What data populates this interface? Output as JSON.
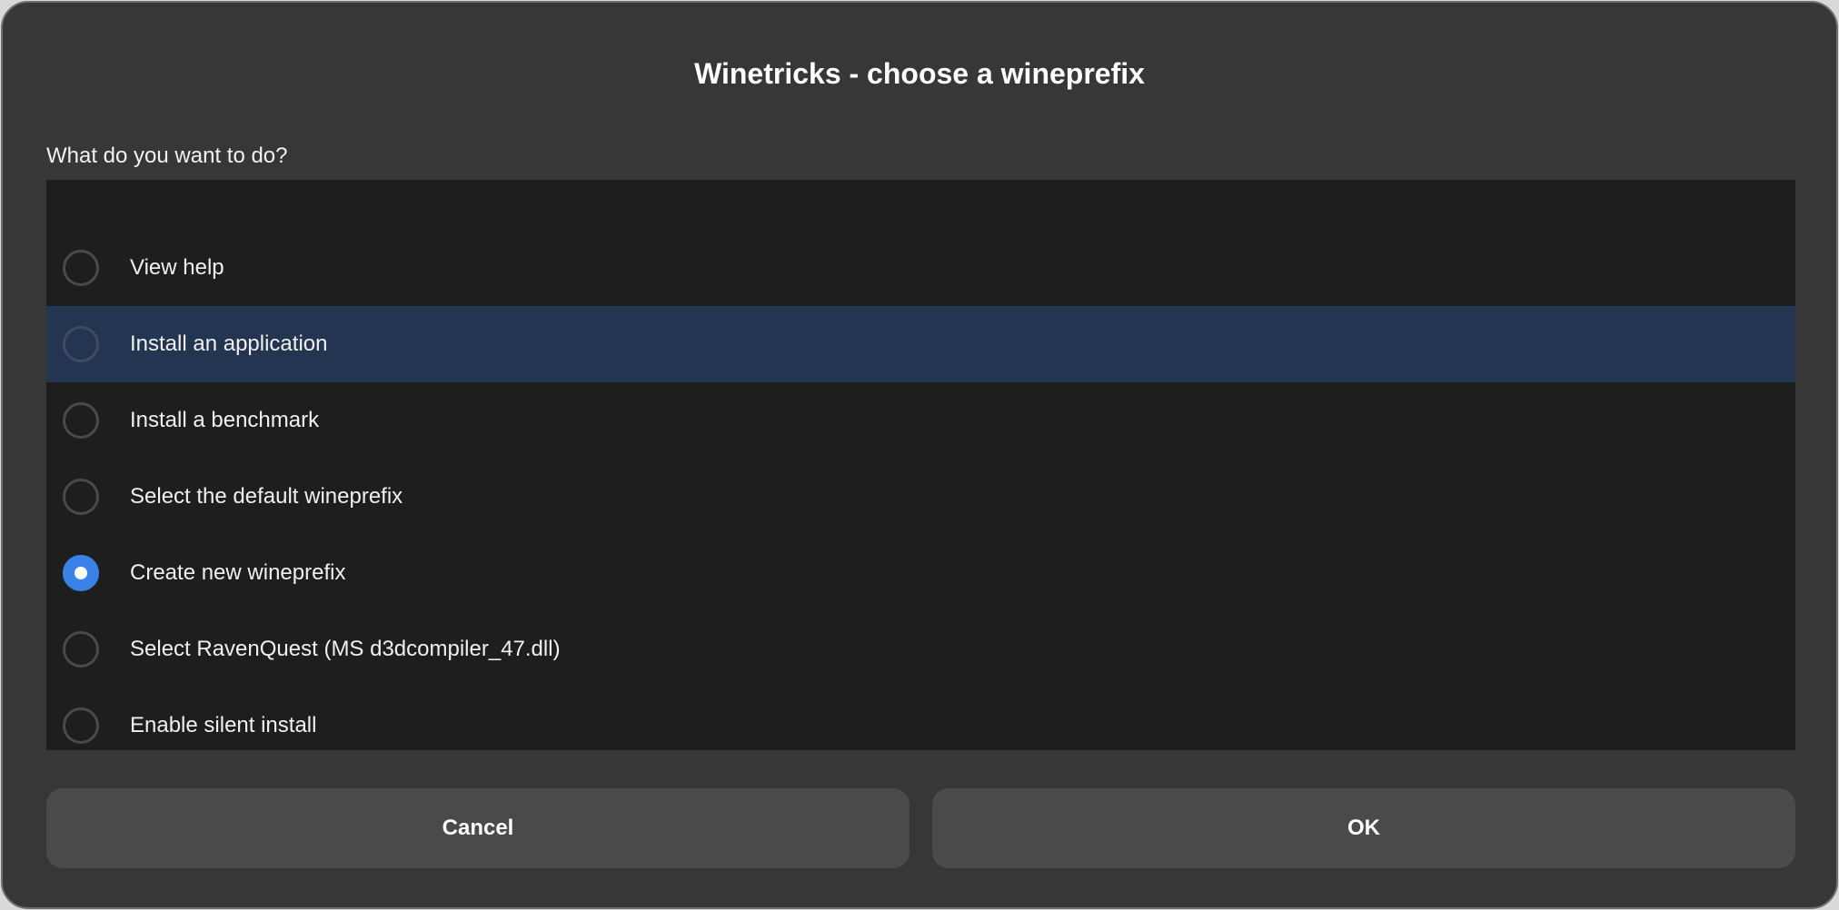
{
  "dialog": {
    "title": "Winetricks - choose a wineprefix",
    "prompt": "What do you want to do?"
  },
  "options": [
    {
      "label": "View help",
      "selected": false
    },
    {
      "label": "Install an application",
      "selected": false,
      "highlighted": true
    },
    {
      "label": "Install a benchmark",
      "selected": false
    },
    {
      "label": "Select the default wineprefix",
      "selected": false
    },
    {
      "label": "Create new wineprefix",
      "selected": true
    },
    {
      "label": "Select RavenQuest (MS d3dcompiler_47.dll)",
      "selected": false
    },
    {
      "label": "Enable silent install",
      "selected": false
    }
  ],
  "buttons": {
    "cancel_label": "Cancel",
    "ok_label": "OK"
  },
  "colors": {
    "dialog_bg": "#373737",
    "list_bg": "#1e1e1e",
    "highlight_row": "#233550",
    "radio_checked": "#3b82e8",
    "button_bg": "#4a4a4a"
  }
}
